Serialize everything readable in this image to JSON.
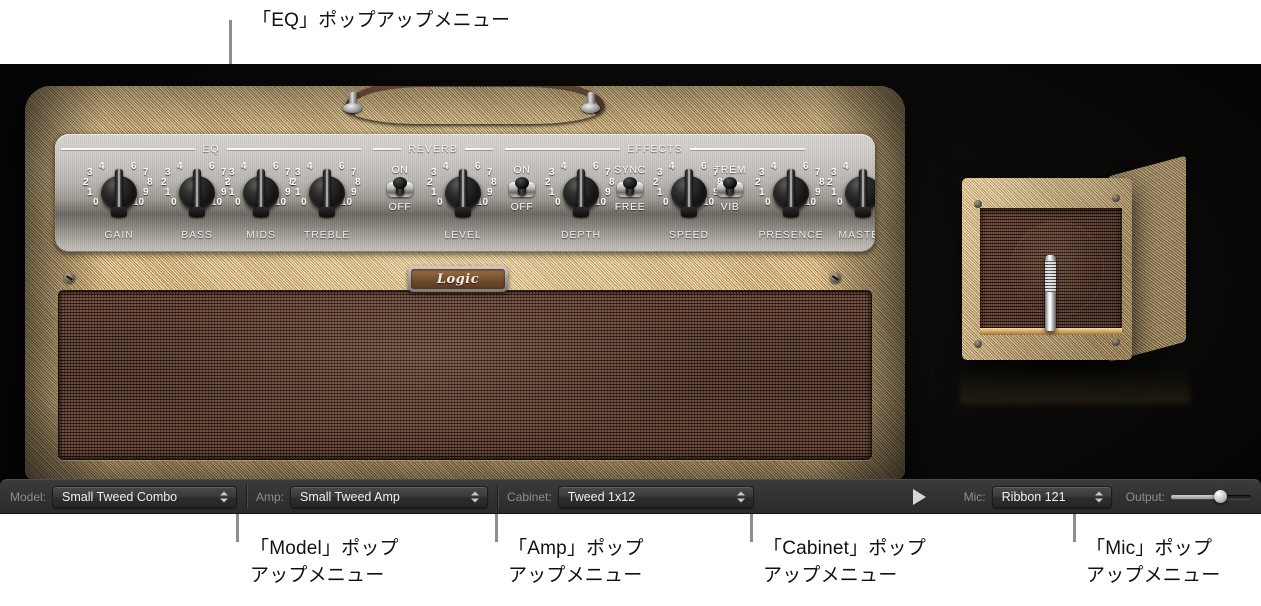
{
  "callouts": {
    "eq": "「EQ」ポップアップメニュー",
    "model": "「Model」ポップ\nアップメニュー",
    "amp": "「Amp」ポップ\nアップメニュー",
    "cabinet": "「Cabinet」ポップ\nアップメニュー",
    "mic": "「Mic」ポップ\nアップメニュー"
  },
  "amp": {
    "brand_badge": "Logic",
    "sections": [
      {
        "name": "eq",
        "label": "EQ"
      },
      {
        "name": "reverb",
        "label": "REVERB"
      },
      {
        "name": "effects",
        "label": "EFFECTS"
      }
    ],
    "scale_numbers": [
      "0",
      "1",
      "2",
      "3",
      "4",
      "6",
      "7",
      "8",
      "9",
      "10"
    ],
    "knobs": [
      {
        "name": "gain",
        "label": "GAIN"
      },
      {
        "name": "bass",
        "label": "BASS"
      },
      {
        "name": "mids",
        "label": "MIDS"
      },
      {
        "name": "treble",
        "label": "TREBLE"
      },
      {
        "name": "level",
        "label": "LEVEL"
      },
      {
        "name": "depth",
        "label": "DEPTH"
      },
      {
        "name": "speed",
        "label": "SPEED"
      },
      {
        "name": "presence",
        "label": "PRESENCE"
      },
      {
        "name": "master",
        "label": "MASTER"
      }
    ],
    "toggles": [
      {
        "name": "reverb-switch",
        "top_label": "ON",
        "bottom_label": "OFF"
      },
      {
        "name": "effects-switch",
        "top_label": "ON",
        "bottom_label": "OFF"
      },
      {
        "name": "sync-switch",
        "top_label": "SYNC",
        "bottom_label": "FREE"
      },
      {
        "name": "trem-vib-switch",
        "top_label": "TREM",
        "bottom_label": "VIB"
      }
    ]
  },
  "toolbar": {
    "model_label": "Model:",
    "model_value": "Small Tweed Combo",
    "amp_label": "Amp:",
    "amp_value": "Small Tweed Amp",
    "cabinet_label": "Cabinet:",
    "cabinet_value": "Tweed 1x12",
    "play_icon": "play-triangle-icon",
    "mic_label": "Mic:",
    "mic_value": "Ribbon 121",
    "output_label": "Output:",
    "output_position_percent": 62
  },
  "colors": {
    "tweed": "#d8b271",
    "grille": "#53352b",
    "panel": "#bab6b1",
    "toolbar_bg": "#343434",
    "callout_text": "#111111",
    "leader_line": "#8d8d8d"
  }
}
